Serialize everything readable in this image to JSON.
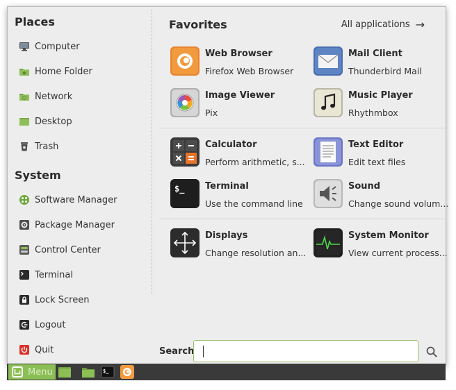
{
  "places": {
    "title": "Places",
    "items": [
      {
        "label": "Computer",
        "icon": "computer-icon"
      },
      {
        "label": "Home Folder",
        "icon": "home-folder-icon"
      },
      {
        "label": "Network",
        "icon": "network-folder-icon"
      },
      {
        "label": "Desktop",
        "icon": "desktop-folder-icon"
      },
      {
        "label": "Trash",
        "icon": "trash-icon"
      }
    ]
  },
  "system": {
    "title": "System",
    "items": [
      {
        "label": "Software Manager",
        "icon": "software-manager-icon"
      },
      {
        "label": "Package Manager",
        "icon": "package-manager-icon"
      },
      {
        "label": "Control Center",
        "icon": "control-center-icon"
      },
      {
        "label": "Terminal",
        "icon": "terminal-icon"
      },
      {
        "label": "Lock Screen",
        "icon": "lock-icon"
      },
      {
        "label": "Logout",
        "icon": "logout-icon"
      },
      {
        "label": "Quit",
        "icon": "power-icon"
      }
    ]
  },
  "favorites": {
    "title": "Favorites",
    "all_apps_label": "All applications",
    "apps": [
      {
        "name": "Web Browser",
        "desc": "Firefox Web Browser",
        "icon": "firefox-icon"
      },
      {
        "name": "Mail Client",
        "desc": "Thunderbird Mail",
        "icon": "mail-icon"
      },
      {
        "name": "Image Viewer",
        "desc": "Pix",
        "icon": "image-viewer-icon"
      },
      {
        "name": "Music Player",
        "desc": "Rhythmbox",
        "icon": "music-note-icon"
      },
      {
        "name": "Calculator",
        "desc": "Perform arithmetic, s...",
        "icon": "calculator-icon"
      },
      {
        "name": "Text Editor",
        "desc": "Edit text files",
        "icon": "text-editor-icon"
      },
      {
        "name": "Terminal",
        "desc": "Use the command line",
        "icon": "terminal-icon"
      },
      {
        "name": "Sound",
        "desc": "Change sound volum...",
        "icon": "speaker-icon"
      },
      {
        "name": "Displays",
        "desc": "Change resolution an...",
        "icon": "displays-icon"
      },
      {
        "name": "System Monitor",
        "desc": "View current process...",
        "icon": "system-monitor-icon"
      }
    ]
  },
  "search": {
    "label": "Search:",
    "value": "",
    "placeholder": ""
  },
  "taskbar": {
    "menu_label": "Menu"
  },
  "colors": {
    "accent": "#8cbe56",
    "taskbar": "#3a3a3a",
    "window_bg": "#ededed"
  }
}
